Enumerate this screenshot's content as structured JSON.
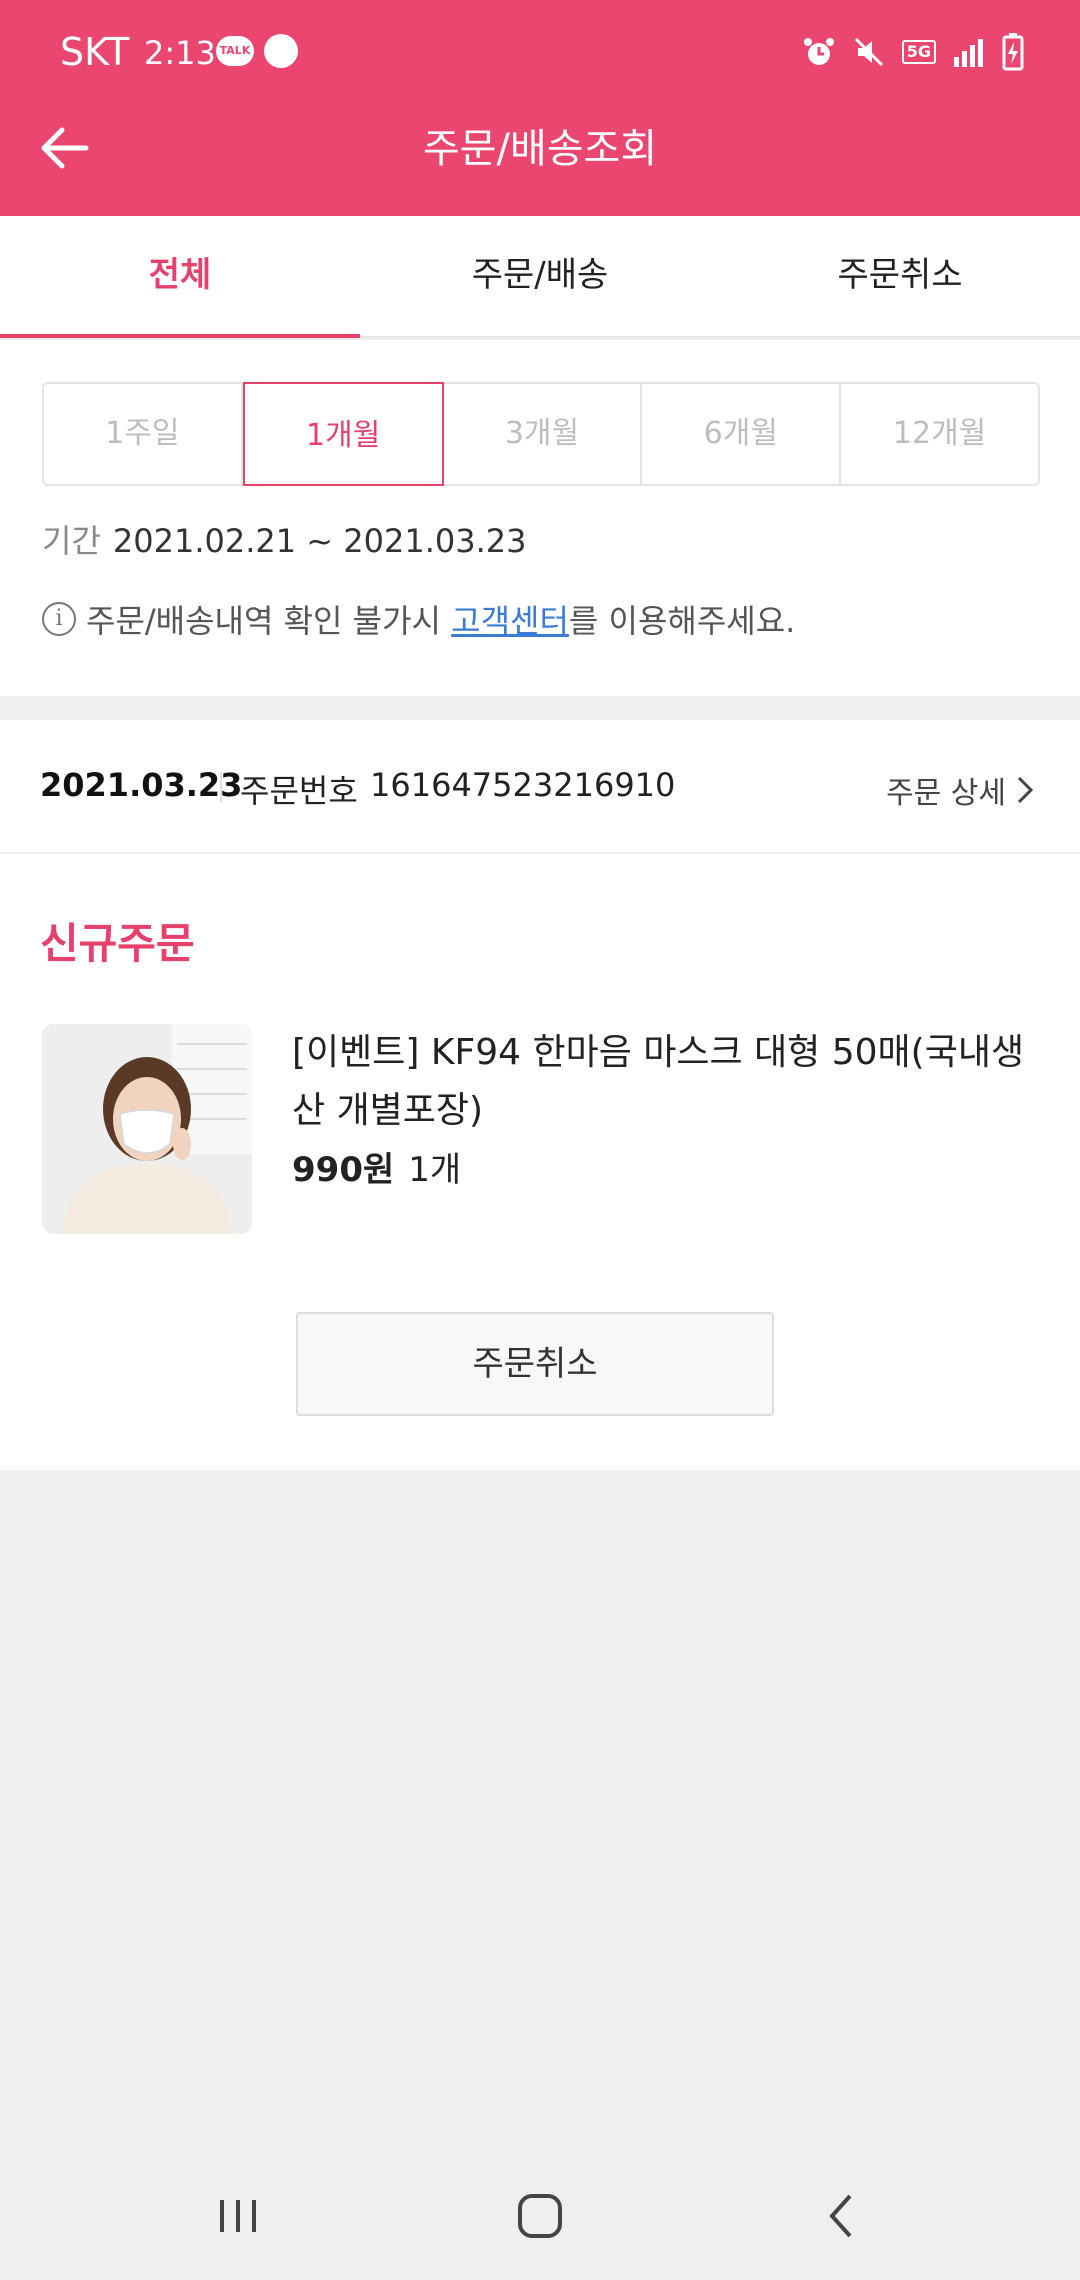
{
  "status_bar": {
    "carrier": "SKT",
    "time": "2:13",
    "talk_badge": "TALK",
    "network": "5G"
  },
  "header": {
    "title": "주문/배송조회"
  },
  "tabs": [
    {
      "label": "전체",
      "active": true
    },
    {
      "label": "주문/배송",
      "active": false
    },
    {
      "label": "주문취소",
      "active": false
    }
  ],
  "filter": {
    "periods": [
      {
        "label": "1주일",
        "active": false
      },
      {
        "label": "1개월",
        "active": true
      },
      {
        "label": "3개월",
        "active": false
      },
      {
        "label": "6개월",
        "active": false
      },
      {
        "label": "12개월",
        "active": false
      }
    ],
    "range_label": "기간",
    "range_value": "2021.02.21 ~ 2021.03.23",
    "notice_prefix": "주문/배송내역 확인 불가시 ",
    "notice_link": "고객센터",
    "notice_suffix": "를 이용해주세요."
  },
  "order": {
    "date": "2021.03.23",
    "number_label": "주문번호",
    "number": "161647523216910",
    "detail_label": "주문 상세",
    "status": "신규주문",
    "product": {
      "name": "[이벤트] KF94 한마음 마스크 대형 50매(국내생산 개별포장)",
      "price": "990원",
      "quantity": "1개"
    },
    "cancel_label": "주문취소"
  },
  "colors": {
    "brand": "#ea4670",
    "accent": "#e6406d",
    "link": "#3b7bd6"
  }
}
